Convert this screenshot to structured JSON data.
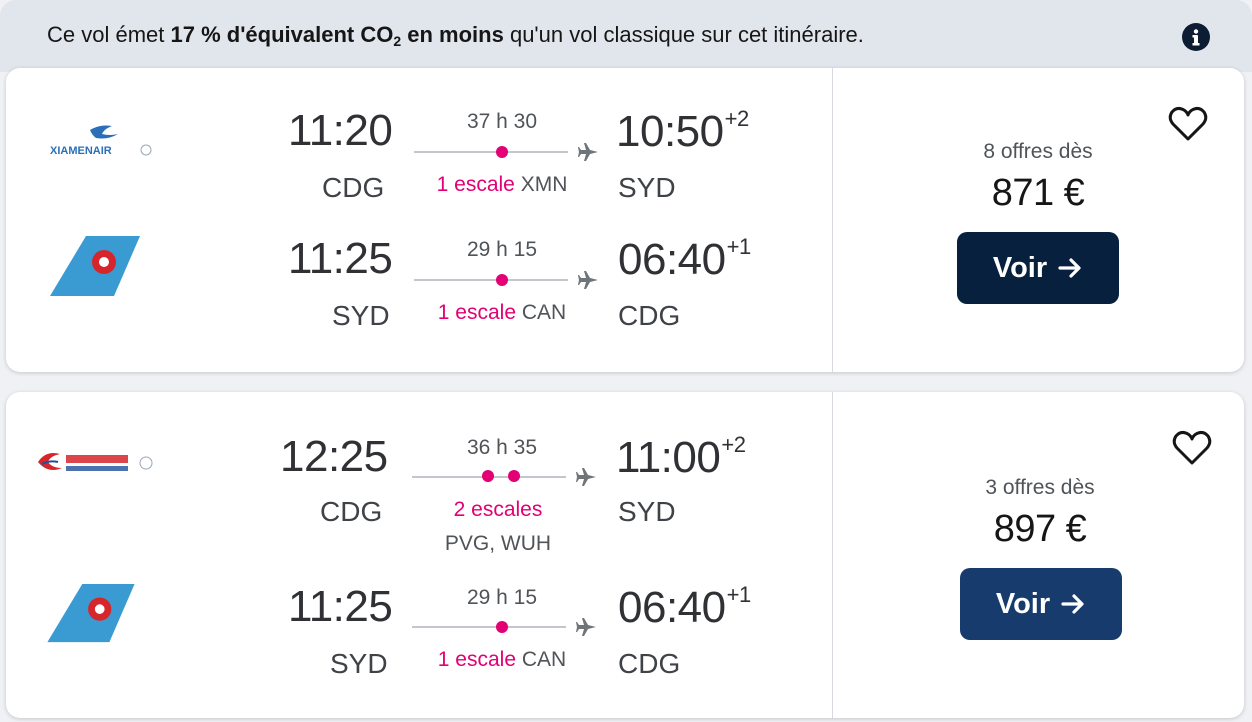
{
  "banner": {
    "text_pre": "Ce vol émet ",
    "text_bold": "17 % d'équivalent CO",
    "text_sub": "2",
    "text_bold2": " en moins",
    "text_post": " qu'un vol classique sur cet itinéraire.",
    "info_icon": "info-icon"
  },
  "results": [
    {
      "outbound": {
        "airline": "XIAMENAIR",
        "depart_time": "11:20",
        "depart_airport": "CDG",
        "duration": "37 h 30",
        "stops_label": "1 escale",
        "stops_via": "XMN",
        "arrive_time": "10:50",
        "arrive_offset": "+2",
        "arrive_airport": "SYD"
      },
      "inbound": {
        "airline": "China Southern",
        "depart_time": "11:25",
        "depart_airport": "SYD",
        "duration": "29 h 15",
        "stops_label": "1 escale",
        "stops_via": "CAN",
        "arrive_time": "06:40",
        "arrive_offset": "+1",
        "arrive_airport": "CDG"
      },
      "offers": "8 offres dès",
      "price": "871 €",
      "button": "Voir"
    },
    {
      "outbound": {
        "airline": "China Eastern",
        "depart_time": "12:25",
        "depart_airport": "CDG",
        "duration": "36 h 35",
        "stops_label": "2 escales",
        "stops_via": "PVG, WUH",
        "arrive_time": "11:00",
        "arrive_offset": "+2",
        "arrive_airport": "SYD"
      },
      "inbound": {
        "airline": "China Southern",
        "depart_time": "11:25",
        "depart_airport": "SYD",
        "duration": "29 h 15",
        "stops_label": "1 escale",
        "stops_via": "CAN",
        "arrive_time": "06:40",
        "arrive_offset": "+1",
        "arrive_airport": "CDG"
      },
      "offers": "3 offres dès",
      "price": "897 €",
      "button": "Voir"
    }
  ],
  "colors": {
    "accent_pink": "#e20074",
    "button_dark": "#06203d",
    "button_blue": "#163b6c"
  }
}
